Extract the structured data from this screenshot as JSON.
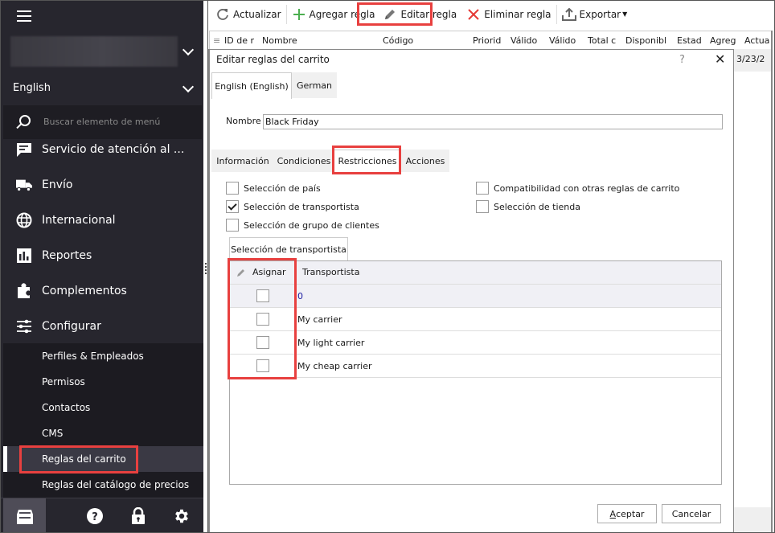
{
  "sidebar": {
    "store_selector": "",
    "language": "English",
    "search_placeholder": "Buscar elemento de menú",
    "items": [
      {
        "label": "Servicio de atención al ...",
        "icon": "chat-icon"
      },
      {
        "label": "Envío",
        "icon": "truck-icon"
      },
      {
        "label": "Internacional",
        "icon": "globe-icon"
      },
      {
        "label": "Reportes",
        "icon": "bar-chart-icon"
      },
      {
        "label": "Complementos",
        "icon": "puzzle-icon"
      },
      {
        "label": "Configurar",
        "icon": "sliders-icon"
      }
    ],
    "subitems": [
      {
        "label": "Perfiles & Empleados"
      },
      {
        "label": "Permisos"
      },
      {
        "label": "Contactos"
      },
      {
        "label": "CMS"
      },
      {
        "label": "Reglas del carrito",
        "active": true
      },
      {
        "label": "Reglas del catálogo de precios"
      }
    ],
    "bottom_icons": [
      "home-store-icon",
      "help-icon",
      "lock-icon",
      "gear-icon"
    ]
  },
  "toolbar": {
    "refresh": "Actualizar",
    "add": "Agregar regla",
    "edit": "Editar regla",
    "delete": "Eliminar regla",
    "export": "Exportar"
  },
  "grid": {
    "columns": [
      "ID de r",
      "Nombre",
      "Código",
      "Priorid",
      "Válido",
      "Válido",
      "Total c",
      "Disponibl",
      "Estad",
      "Agreg",
      "Actua"
    ],
    "visible_cell": "3/23/2"
  },
  "dialog": {
    "title": "Editar reglas del carrito",
    "help": "?",
    "close": "✕",
    "lang_tabs": [
      "English (English)",
      "German"
    ],
    "name_label": "Nombre",
    "name_value": "Black Friday",
    "section_tabs": [
      "Información",
      "Condiciones",
      "Restricciones",
      "Acciones"
    ],
    "active_section": "Restricciones",
    "restrictions": [
      {
        "label": "Selección de país",
        "checked": false
      },
      {
        "label": "Selección de transportista",
        "checked": true
      },
      {
        "label": "Selección de grupo de clientes",
        "checked": false
      },
      {
        "label": "Compatibilidad con otras reglas de carrito",
        "checked": false
      },
      {
        "label": "Selección de tienda",
        "checked": false
      }
    ],
    "carrier_tab": "Selección de transportista",
    "carrier_grid": {
      "col_assign": "Asignar",
      "col_carrier": "Transportista",
      "rows": [
        {
          "name": "0",
          "assigned": false
        },
        {
          "name": "My carrier",
          "assigned": false
        },
        {
          "name": "My light carrier",
          "assigned": false
        },
        {
          "name": "My cheap carrier",
          "assigned": false
        }
      ]
    },
    "ok_prefix": "A",
    "ok_rest": "ceptar",
    "cancel": "Cancelar"
  },
  "colors": {
    "sidebar_bg": "#27262e",
    "highlight": "#e8403f",
    "add_green": "#4caf50",
    "delete_red": "#e53935"
  }
}
